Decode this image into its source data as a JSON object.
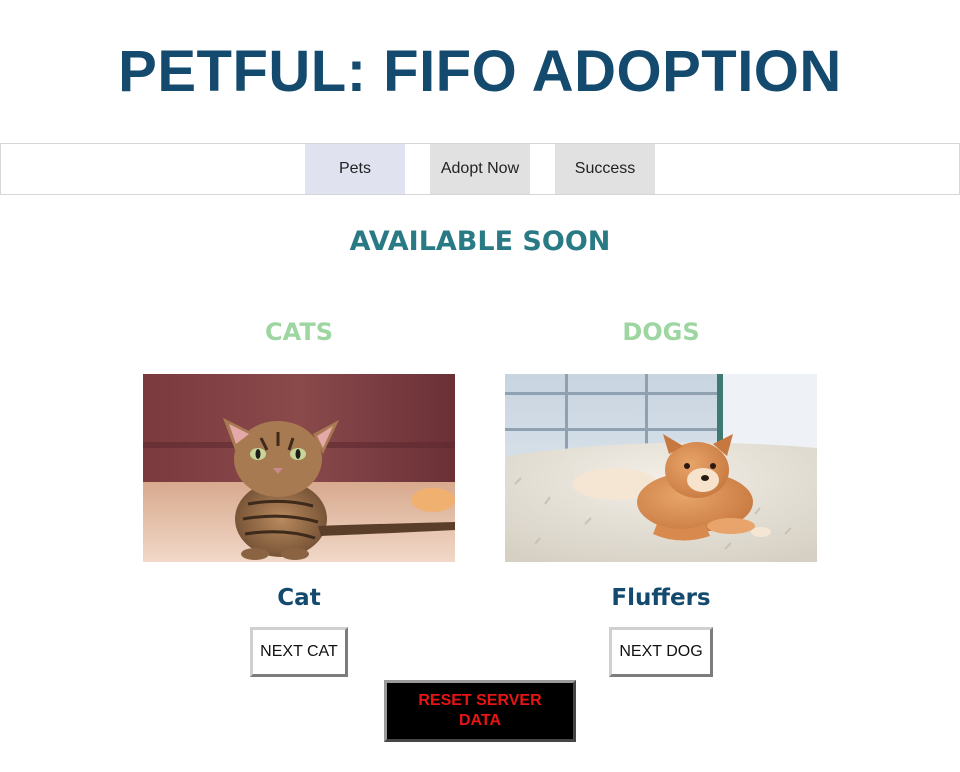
{
  "header": {
    "title": "PETFUL: FIFO ADOPTION"
  },
  "nav": {
    "tabs": [
      {
        "label": "Pets",
        "active": true
      },
      {
        "label": "Adopt Now",
        "active": false
      },
      {
        "label": "Success",
        "active": false
      }
    ]
  },
  "main": {
    "heading": "AVAILABLE SOON",
    "cats": {
      "heading": "CATS",
      "pet_name": "Cat",
      "next_label": "NEXT CAT",
      "image": "kitten-photo"
    },
    "dogs": {
      "heading": "DOGS",
      "pet_name": "Fluffers",
      "next_label": "NEXT DOG",
      "image": "shiba-dog-photo"
    }
  },
  "footer": {
    "reset_label": "RESET SERVER DATA"
  },
  "colors": {
    "title": "#134a6e",
    "section_heading": "#2a7a86",
    "column_heading": "#9ed6a2",
    "pet_name": "#134a6e",
    "reset_text": "#e81414",
    "reset_bg": "#000000"
  }
}
